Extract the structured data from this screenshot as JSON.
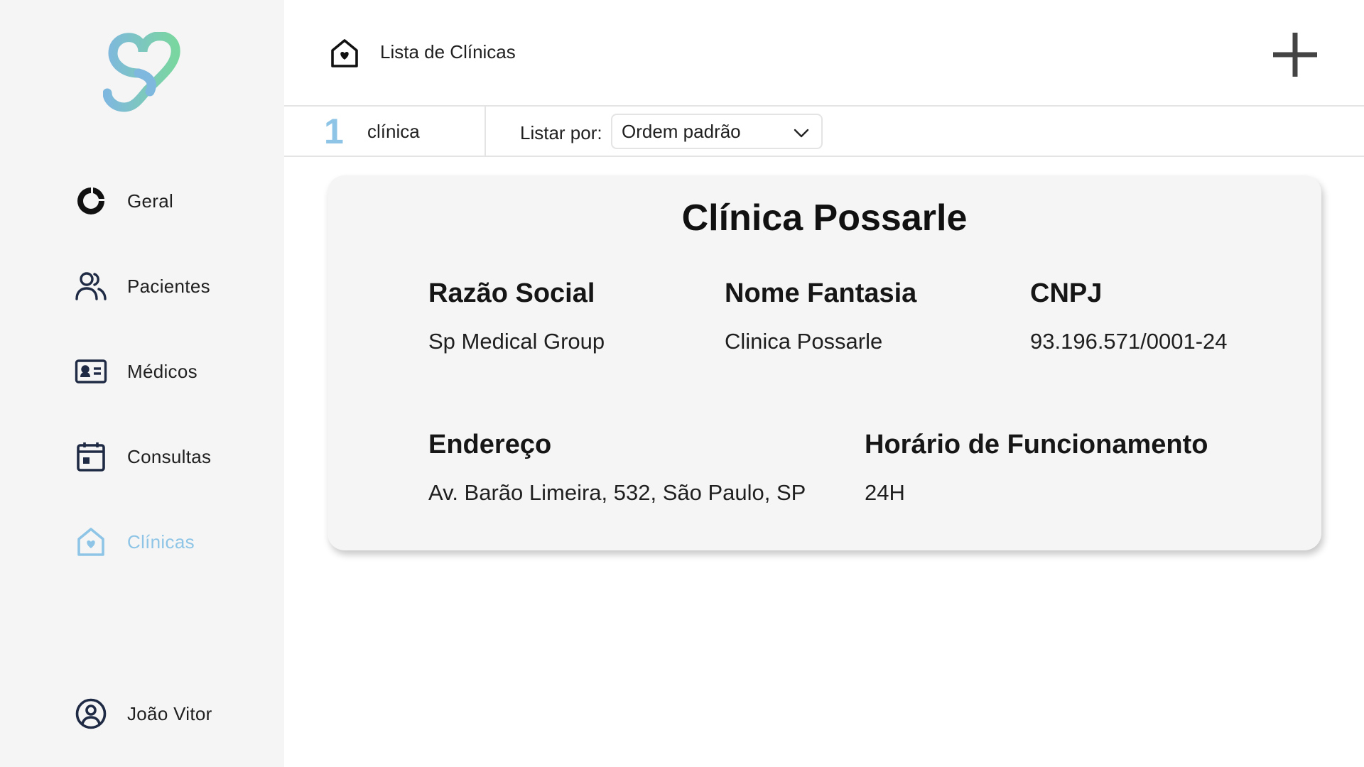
{
  "sidebar": {
    "items": [
      {
        "label": "Geral",
        "icon": "pie-chart-icon"
      },
      {
        "label": "Pacientes",
        "icon": "users-icon"
      },
      {
        "label": "Médicos",
        "icon": "id-card-icon"
      },
      {
        "label": "Consultas",
        "icon": "calendar-icon"
      },
      {
        "label": "Clínicas",
        "icon": "clinic-house-icon",
        "active": true
      }
    ],
    "user": {
      "label": "João Vitor",
      "icon": "user-circle-icon"
    }
  },
  "header": {
    "title": "Lista de Clínicas",
    "icon": "clinic-house-icon",
    "add_icon": "plus-icon"
  },
  "toolbar": {
    "count": "1",
    "count_label": "clínica",
    "sort_label": "Listar por:",
    "sort_value": "Ordem padrão"
  },
  "clinic": {
    "title": "Clínica Possarle",
    "razao_social_label": "Razão Social",
    "razao_social": "Sp Medical Group",
    "nome_fantasia_label": "Nome Fantasia",
    "nome_fantasia": "Clinica Possarle",
    "cnpj_label": "CNPJ",
    "cnpj": "93.196.571/0001-24",
    "endereco_label": "Endereço",
    "endereco": "Av. Barão Limeira, 532, São Paulo, SP",
    "horario_label": "Horário de Funcionamento",
    "horario": "24H"
  },
  "colors": {
    "accent": "#8ec5e6",
    "logo_blue": "#7fb8de",
    "logo_green": "#7ad6a0",
    "sidebar_bg": "#f5f5f5",
    "card_bg": "#f5f5f5"
  }
}
